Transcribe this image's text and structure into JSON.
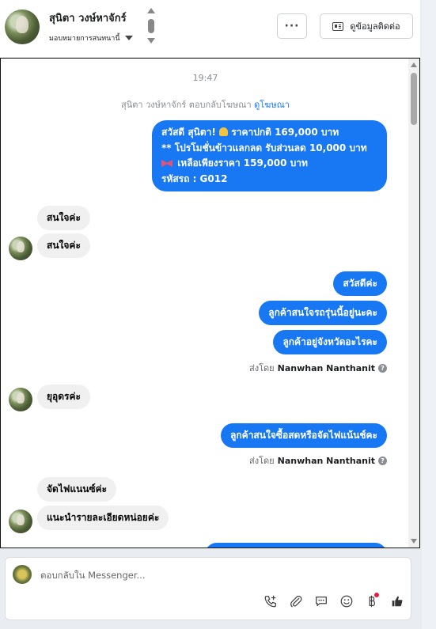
{
  "header": {
    "contact_name": "สุนิตา วงษ์หาจักร์",
    "assign_label": "มอบหมายการสนทนานี้",
    "more_label": "···",
    "view_contact_label": "ดูข้อมูลติดต่อ"
  },
  "chat": {
    "timestamp": "19:47",
    "reply_note": "สุนิตา วงษ์หาจักร์ ตอบกลับโฆษณา",
    "reply_link": "ดูโฆษณา",
    "ad_message": {
      "line1": "สวัสดี สุนิตา!",
      "line1_price": "ราคาปกติ 169,000 บาท",
      "line2": "** โปรโมชั่นข้าวแลกลด รับส่วนลด 10,000 บาท",
      "line3": "เหลือเพียงราคา 159,000 บาท",
      "line4": "รหัสรถ : G012"
    },
    "in1a": "สนใจค่ะ",
    "in1b": "สนใจค่ะ",
    "out1": "สวัสดีค่ะ",
    "out2": "ลูกค้าสนใจรถรุ่นนี้อยู่นะคะ",
    "out3": "ลูกค้าอยู่จังหวัดอะไรคะ",
    "sent_by_label": "ส่งโดย",
    "sender_name": "Nanwhan Nanthanit",
    "in2": "ยุอุดรค่ะ",
    "out4": "ลูกค้าสนใจซื้อสดหรือจัดไฟแน้นช์คะ",
    "in3a": "จัดไฟแนนซ์ค่ะ",
    "in3b": "แนะนำรายละเอียดหน่อยค่ะ"
  },
  "composer": {
    "placeholder": "ตอบกลับใน Messenger...",
    "tools": [
      "call-add-icon",
      "attachment-icon",
      "saved-reply-icon",
      "emoji-icon",
      "payment-icon",
      "like-icon"
    ]
  },
  "colors": {
    "accent": "#1877f2",
    "incoming": "#f0f0f0"
  }
}
